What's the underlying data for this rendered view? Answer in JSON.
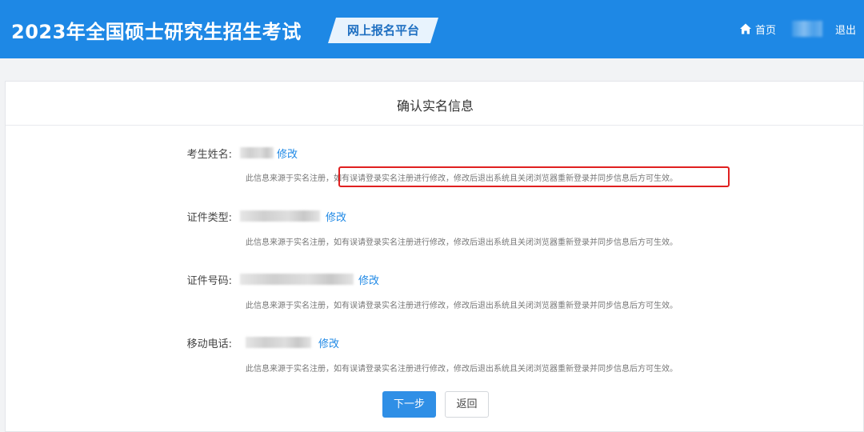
{
  "header": {
    "site_title": "2023年全国硕士研究生招生考试",
    "platform_label": "网上报名平台",
    "nav_home_label": "首页",
    "home_icon": "home-icon",
    "logout_label": "退出",
    "brand_color": "#1e88e5"
  },
  "card": {
    "title": "确认实名信息"
  },
  "fields": [
    {
      "label": "考生姓名:",
      "edit_label": "修改",
      "hint": "此信息来源于实名注册，如有误请登录实名注册进行修改，修改后退出系统且关闭浏览器重新登录并同步信息后方可生效。"
    },
    {
      "label": "证件类型:",
      "edit_label": "修改",
      "hint": "此信息来源于实名注册，如有误请登录实名注册进行修改，修改后退出系统且关闭浏览器重新登录并同步信息后方可生效。"
    },
    {
      "label": "证件号码:",
      "edit_label": "修改",
      "hint": "此信息来源于实名注册，如有误请登录实名注册进行修改，修改后退出系统且关闭浏览器重新登录并同步信息后方可生效。"
    },
    {
      "label": "移动电话:",
      "edit_label": "修改",
      "hint": "此信息来源于实名注册，如有误请登录实名注册进行修改，修改后退出系统且关闭浏览器重新登录并同步信息后方可生效。"
    }
  ],
  "actions": {
    "next_label": "下一步",
    "back_label": "返回"
  },
  "colors": {
    "accent": "#1e88e5",
    "highlight_border": "#e02020"
  }
}
